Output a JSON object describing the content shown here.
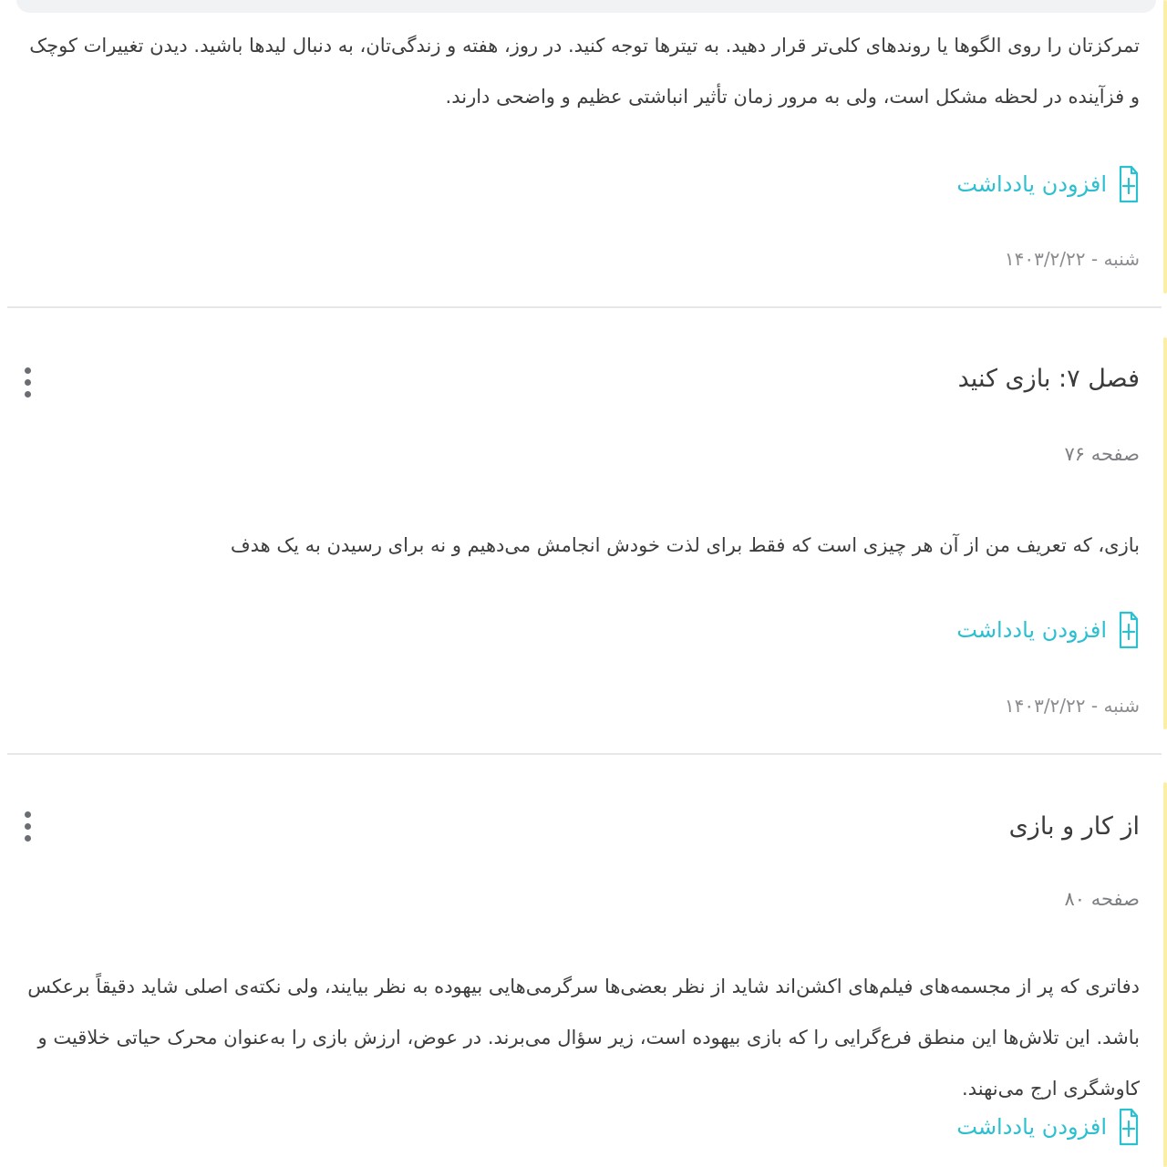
{
  "highlights": [
    {
      "text": "تمرکزتان را روی الگوها یا روندهای کلی‌تر قرار دهید. به تیترها توجه کنید. در روز، هفته و زندگی‌تان، به دنبال لیدها باشید. دیدن تغییرات کوچک و فزآینده در لحظه مشکل است، ولی به مرور زمان تأثیر انباشتی عظیم و واضحی دارند.",
      "add_note_label": "افزودن یادداشت",
      "date": "شنبه - ۱۴۰۳/۲/۲۲"
    },
    {
      "title": "فصل ۷: بازی کنید",
      "page": "صفحه ۷۶",
      "text": "بازی، که تعریف من از آن هر چیزی است که فقط برای لذت خودش انجامش می‌دهیم و نه برای رسیدن به یک هدف",
      "add_note_label": "افزودن یادداشت",
      "date": "شنبه - ۱۴۰۳/۲/۲۲"
    },
    {
      "title": "از کار و بازی",
      "page": "صفحه ۸۰",
      "text": "دفاتری که پر از مجسمه‌های فیلم‌های اکشن‌اند شاید از نظر بعضی‌ها سرگرمی‌هایی بیهوده به نظر بیایند، ولی نکته‌ی اصلی شاید دقیقاً برعکس باشد. این تلاش‌ها این منطق فرع‌گرایی را که بازی بیهوده است، زیر سؤال می‌برند. در عوض، ارزش بازی را به‌عنوان محرک حیاتی خلاقیت و کاوشگری ارج می‌نهند.",
      "add_note_label": "افزودن یادداشت"
    }
  ],
  "colors": {
    "accent": "#2cbfcf",
    "highlight_bar": "#fbefa8",
    "divider": "#e6e7e9"
  },
  "icons": {
    "add_note": "note-plus-icon",
    "menu": "more-vertical-icon"
  }
}
